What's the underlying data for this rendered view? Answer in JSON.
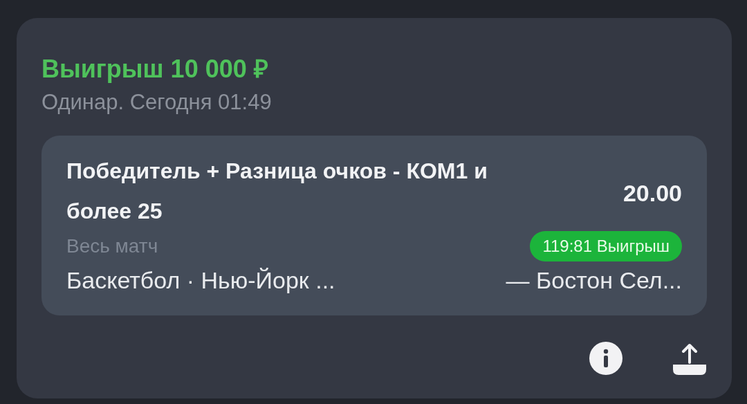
{
  "header": {
    "title": "Выигрыш 10 000 ₽",
    "subtitle": "Одинар. Сегодня 01:49"
  },
  "bet": {
    "market": "Победитель + Разница очков - КОМ1 и более 25",
    "odds": "20.00",
    "period": "Весь матч",
    "result_badge": "119:81 Выигрыш",
    "event_sport_team1": "Баскетбол · Нью-Йорк ...",
    "event_team2": "— Бостон Сел..."
  }
}
